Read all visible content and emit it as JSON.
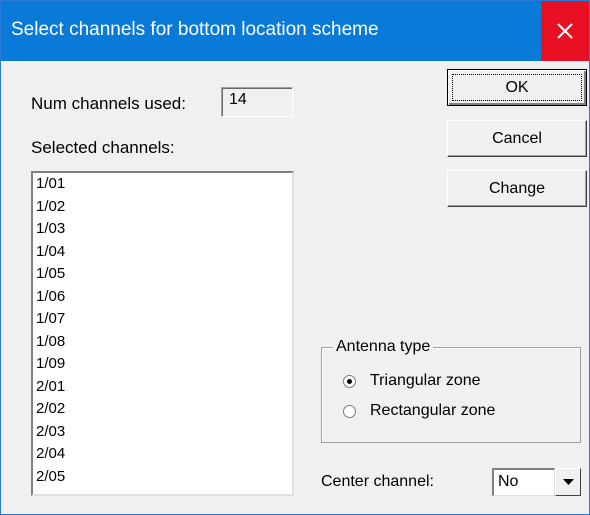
{
  "window": {
    "title": "Select channels for bottom location scheme"
  },
  "num_channels": {
    "label": "Num channels used:",
    "value": "14"
  },
  "selected": {
    "label": "Selected channels:",
    "items": [
      "1/01",
      "1/02",
      "1/03",
      "1/04",
      "1/05",
      "1/06",
      "1/07",
      "1/08",
      "1/09",
      "2/01",
      "2/02",
      "2/03",
      "2/04",
      "2/05"
    ]
  },
  "buttons": {
    "ok": "OK",
    "cancel": "Cancel",
    "change": "Change"
  },
  "antenna": {
    "legend": "Antenna type",
    "options": [
      "Triangular zone",
      "Rectangular zone"
    ],
    "selected": "Triangular zone"
  },
  "center_channel": {
    "label": "Center channel:",
    "value": "No"
  },
  "icons": {
    "close": "close-icon",
    "dropdown": "chevron-down-icon"
  },
  "colors": {
    "titlebar": "#0a7ad8",
    "close": "#e81123"
  }
}
